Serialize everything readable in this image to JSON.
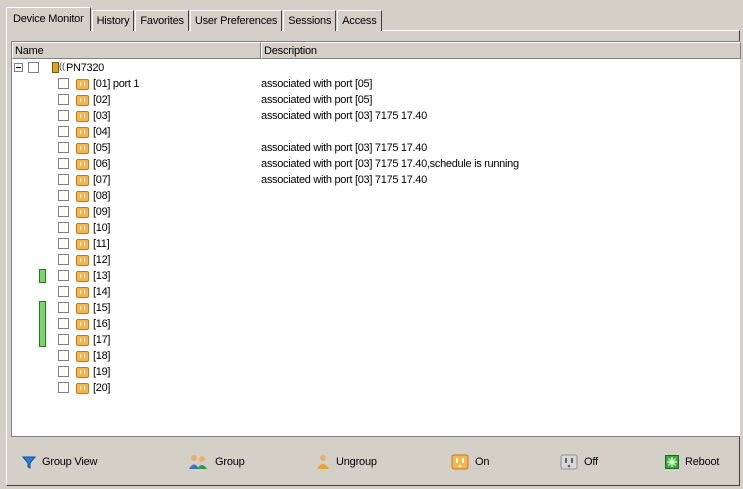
{
  "tabs": [
    {
      "label": "Device Monitor",
      "active": true
    },
    {
      "label": "History"
    },
    {
      "label": "Favorites"
    },
    {
      "label": "User Preferences"
    },
    {
      "label": "Sessions"
    },
    {
      "label": "Access"
    }
  ],
  "columns": {
    "name": "Name",
    "description": "Description"
  },
  "device": {
    "name": "PN7320"
  },
  "ports": [
    {
      "name": "[01] port 1",
      "description": "associated with port [05]"
    },
    {
      "name": "[02]",
      "description": "associated with port [05]"
    },
    {
      "name": "[03]",
      "description": "associated with port [03] 7175 17.40"
    },
    {
      "name": "[04]",
      "description": ""
    },
    {
      "name": "[05]",
      "description": "associated with port [03] 7175 17.40"
    },
    {
      "name": "[06]",
      "description": "associated with port [03] 7175 17.40,schedule is running"
    },
    {
      "name": "[07]",
      "description": "associated with port [03] 7175 17.40"
    },
    {
      "name": "[08]",
      "description": ""
    },
    {
      "name": "[09]",
      "description": ""
    },
    {
      "name": "[10]",
      "description": ""
    },
    {
      "name": "[11]",
      "description": ""
    },
    {
      "name": "[12]",
      "description": ""
    },
    {
      "name": "[13]",
      "description": ""
    },
    {
      "name": "[14]",
      "description": ""
    },
    {
      "name": "[15]",
      "description": ""
    },
    {
      "name": "[16]",
      "description": ""
    },
    {
      "name": "[17]",
      "description": ""
    },
    {
      "name": "[18]",
      "description": ""
    },
    {
      "name": "[19]",
      "description": ""
    },
    {
      "name": "[20]",
      "description": ""
    }
  ],
  "toolbar": {
    "group_view": "Group View",
    "group": "Group",
    "ungroup": "Ungroup",
    "on": "On",
    "off": "Off",
    "reboot": "Reboot"
  },
  "colors": {
    "outlet": "#f7b44a",
    "group_marker": "#7ed36a",
    "window": "#d4d0c8"
  }
}
